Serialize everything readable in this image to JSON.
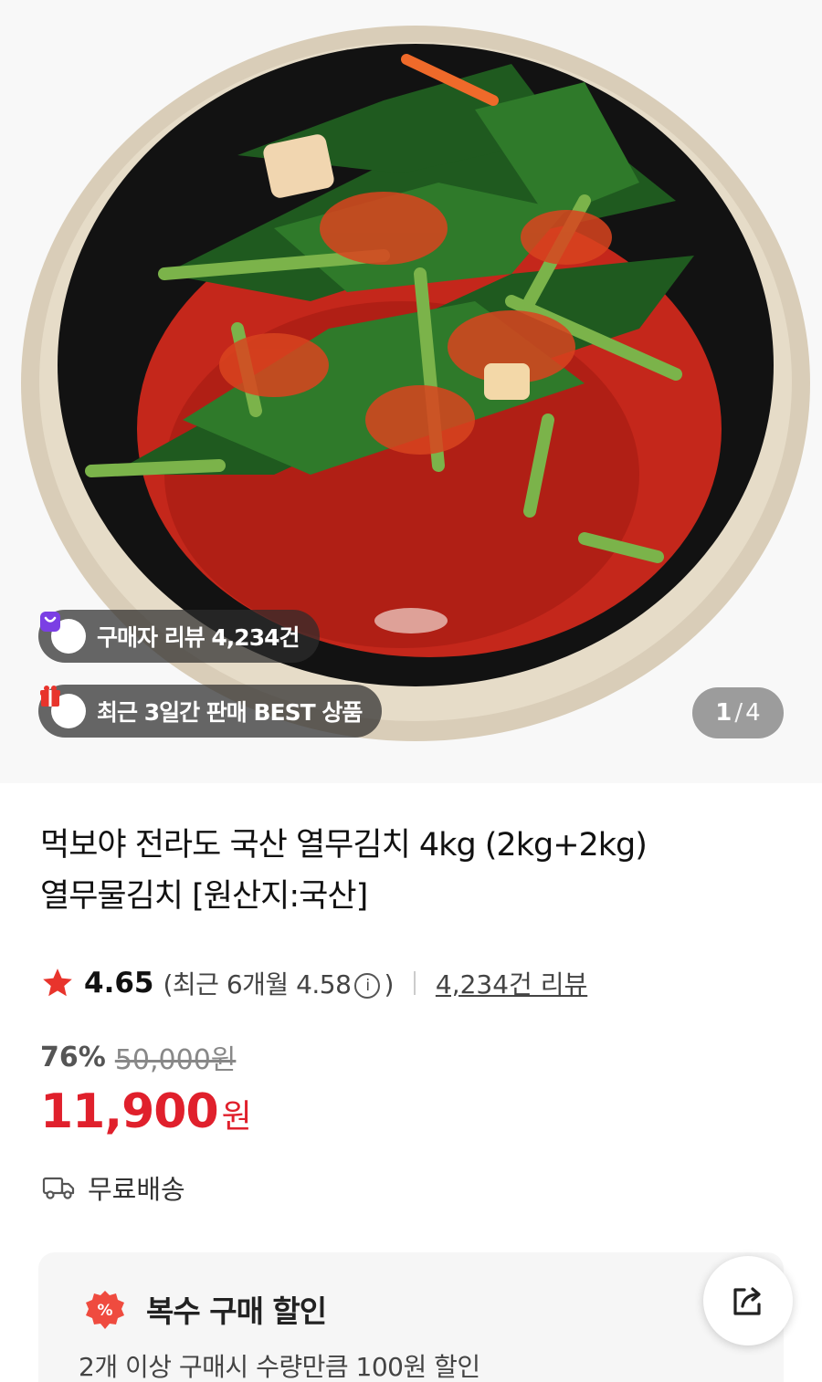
{
  "hero": {
    "image_label": "kimchi-bowl-photo",
    "review_badge": "구매자 리뷰 4,234건",
    "best_badge": "최근 3일간 판매 BEST 상품",
    "pager_current": "1",
    "pager_total": "4",
    "pager_sep": "/"
  },
  "product": {
    "title_line1": "먹보야 전라도 국산 열무김치 4kg (2kg+2kg)",
    "title_line2": "열무물김치 [원산지:국산]",
    "rating": "4.65",
    "recent_rating": "(최근 6개월 4.58",
    "recent_rating_close": ")",
    "info_glyph": "i",
    "review_link": "4,234건 리뷰",
    "discount_rate": "76%",
    "original_price": "50,000원",
    "price": "11,900",
    "currency": "원",
    "shipping": "무료배송"
  },
  "coupon": {
    "badge": "%",
    "title": "복수 구매 할인",
    "description": "2개 이상 구매시 수량만큼 100원 할인"
  },
  "colors": {
    "price_red": "#e0202c",
    "star": "#e8342c",
    "review_icon": "#7b3fe4",
    "best_icon": "#e8342c"
  },
  "icons": [
    "star-icon",
    "info-icon",
    "truck-icon",
    "percent-badge-icon",
    "share-icon",
    "review-bag-icon",
    "gift-icon"
  ]
}
